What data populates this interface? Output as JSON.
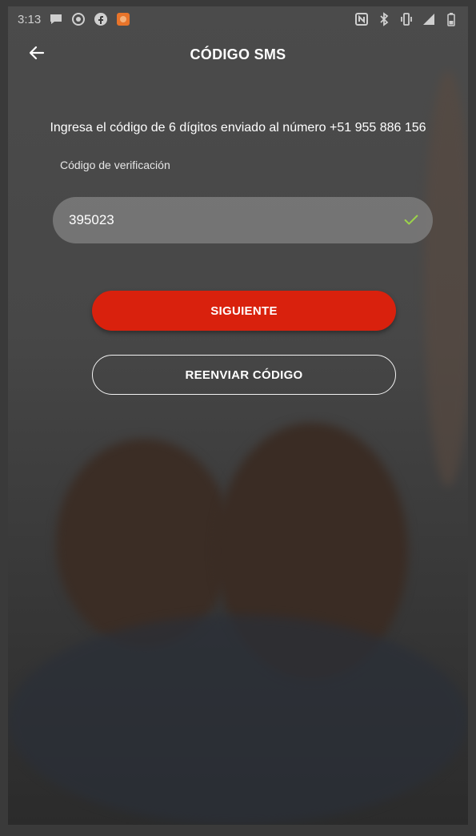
{
  "status_bar": {
    "time": "3:13",
    "left_icons": [
      "chat-bubble-icon",
      "whatsapp-icon",
      "facebook-icon",
      "app-notification-icon"
    ],
    "right_icons": [
      "nfc-icon",
      "bluetooth-icon",
      "vibrate-icon",
      "signal-icon",
      "battery-icon"
    ]
  },
  "header": {
    "back_icon": "arrow-left-icon",
    "title": "CÓDIGO SMS"
  },
  "main": {
    "instructions": "Ingresa el código de 6 dígitos enviado al número +51 955 886 156",
    "code_field": {
      "label": "Código de verificación",
      "value": "395023",
      "valid_icon": "check-icon"
    },
    "next_button": "SIGUIENTE",
    "resend_button": "REENVIAR CÓDIGO"
  },
  "colors": {
    "primary": "#d9210d",
    "check": "#9bd34a",
    "overlay": "#3a3a3a"
  }
}
